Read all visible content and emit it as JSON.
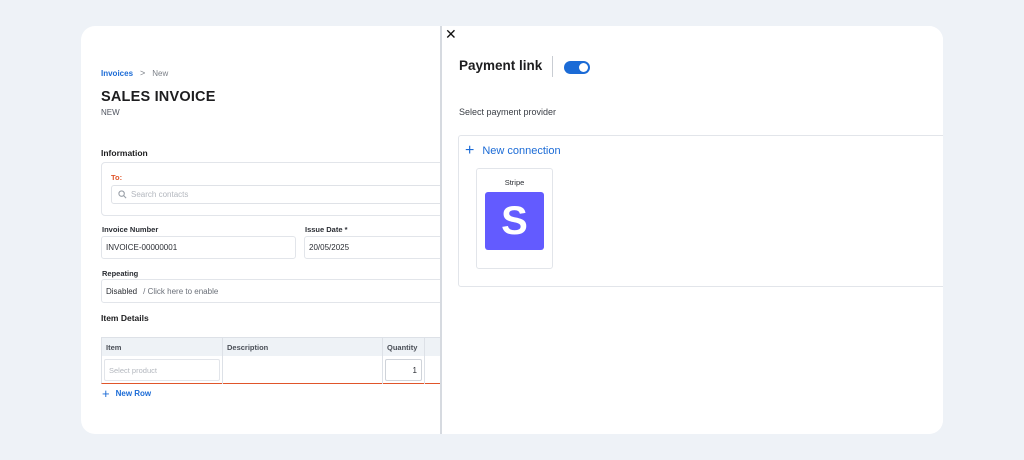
{
  "breadcrumb": {
    "parent": "Invoices",
    "separator": ">",
    "current": "New"
  },
  "page": {
    "title": "SALES INVOICE",
    "status": "NEW"
  },
  "information": {
    "heading": "Information",
    "to_label": "To:",
    "contact_search_placeholder": "Search contacts"
  },
  "fields": {
    "invoice_number_label": "Invoice Number",
    "invoice_number_value": "INVOICE-00000001",
    "issue_date_label": "Issue Date *",
    "issue_date_value": "20/05/2025",
    "repeating_label": "Repeating",
    "repeating_state": "Disabled",
    "repeating_hint": "/ Click here to enable"
  },
  "items": {
    "heading": "Item Details",
    "columns": [
      "Item",
      "Description",
      "Quantity"
    ],
    "row": {
      "item_placeholder": "Select product",
      "description": "",
      "quantity": "1"
    },
    "new_row_label": "New Row"
  },
  "panel": {
    "close_glyph": "✕",
    "title": "Payment link",
    "toggle_on": true,
    "provider_label": "Select payment provider",
    "new_connection_label": "New connection",
    "providers": [
      {
        "name": "Stripe",
        "logo_letter": "S",
        "color": "#635bff"
      }
    ]
  },
  "colors": {
    "accent": "#1b6bd6",
    "required": "#e0552a",
    "stripe": "#635bff"
  },
  "icons": {
    "search": "search-icon",
    "close": "close-icon",
    "plus": "plus-icon",
    "chevron": "chevron-right-icon"
  }
}
